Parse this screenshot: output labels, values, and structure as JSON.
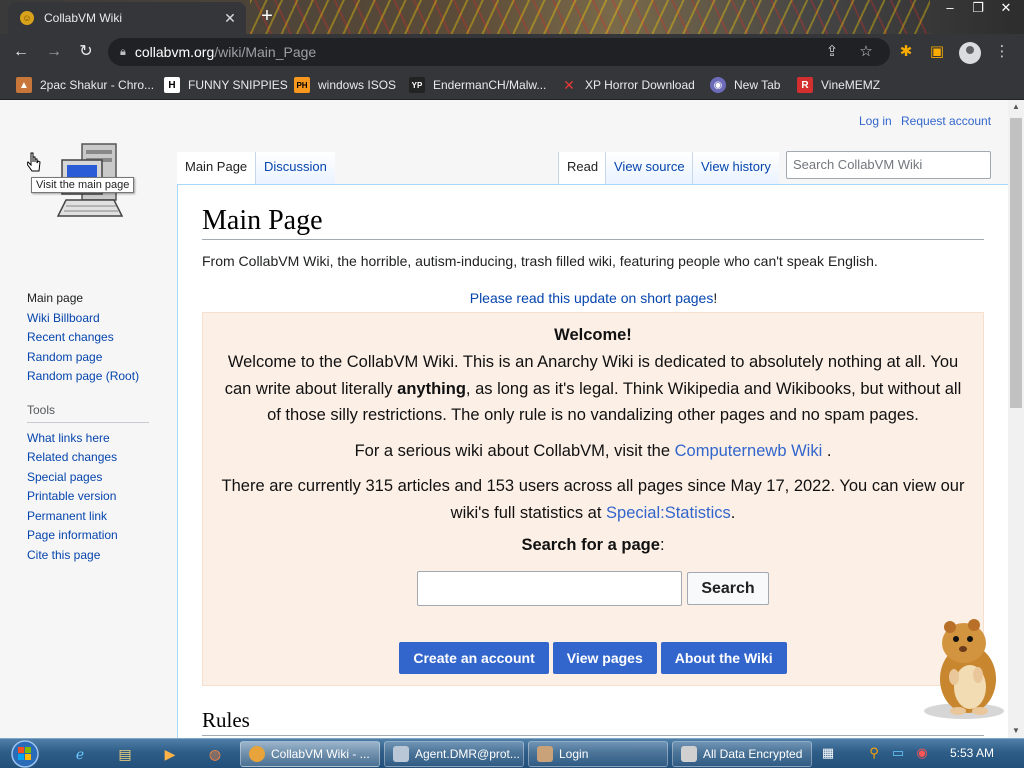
{
  "browser": {
    "tab_title": "CollabVM Wiki",
    "new_tab": "+",
    "url_host": "collabvm.org",
    "url_path": "/wiki/Main_Page",
    "bookmarks": [
      {
        "label": "2pac Shakur - Chro...",
        "icon": "nft-bookmark-icon"
      },
      {
        "label": "FUNNY SNIPPIES",
        "icon": "h-bookmark-icon"
      },
      {
        "label": "windows ISOS",
        "icon": "ph-bookmark-icon"
      },
      {
        "label": "EndermanCH/Malw...",
        "icon": "yp-bookmark-icon"
      },
      {
        "label": "XP Horror Download",
        "icon": "x-bookmark-icon"
      },
      {
        "label": "New Tab",
        "icon": "globe-bookmark-icon"
      },
      {
        "label": "VineMEMZ",
        "icon": "r-bookmark-icon"
      }
    ]
  },
  "wiki": {
    "personal": {
      "login": "Log in",
      "request_account": "Request account"
    },
    "logo_tooltip": "Visit the main page",
    "nav": [
      "Main page",
      "Wiki Billboard",
      "Recent changes",
      "Random page",
      "Random page (Root)"
    ],
    "tools_heading": "Tools",
    "tools": [
      "What links here",
      "Related changes",
      "Special pages",
      "Printable version",
      "Permanent link",
      "Page information",
      "Cite this page"
    ],
    "tabs": {
      "main_page": "Main Page",
      "discussion": "Discussion",
      "read": "Read",
      "view_source": "View source",
      "view_history": "View history"
    },
    "search_placeholder": "Search CollabVM Wiki",
    "title": "Main Page",
    "tagline": "From CollabVM Wiki, the horrible, autism-inducing, trash filled wiki, featuring people who can't speak English.",
    "notice_link": "Please read this update on short pages",
    "notice_suffix": "!",
    "welcome": {
      "heading": "Welcome!",
      "intro_1": "Welcome to the CollabVM Wiki. This is an Anarchy Wiki is dedicated to absolutely nothing at all. You can write about literally ",
      "intro_bold": "anything",
      "intro_2": ", as long as it's legal. Think Wikipedia and Wikibooks, but without all of those silly restrictions. The only rule is no vandalizing other pages and no spam pages.",
      "serious_prefix": "For a serious wiki about CollabVM, visit the ",
      "serious_link": "Computernewb Wiki",
      "serious_suffix": " .",
      "stats_text": "There are currently 315 articles and 153 users across all pages since May 17, 2022. You can view our wiki's full statistics at ",
      "stats_link": "Special:Statistics",
      "stats_suffix": ".",
      "search_label": "Search for a page",
      "search_colon": ":",
      "search_button": "Search",
      "actions": [
        "Create an account",
        "View pages",
        "About the Wiki"
      ]
    },
    "rules_heading": "Rules"
  },
  "taskbar": {
    "buttons": [
      {
        "label": "CollabVM Wiki - ...",
        "color": "#e8a33a",
        "active": true
      },
      {
        "label": "Agent.DMR@prot...",
        "color": "#b9c7d6",
        "active": false
      },
      {
        "label": "Login",
        "color": "#c9a27a",
        "active": false
      },
      {
        "label": "All Data Encrypted",
        "color": "#d0d0d0",
        "active": false
      }
    ],
    "clock": "5:53 AM"
  }
}
